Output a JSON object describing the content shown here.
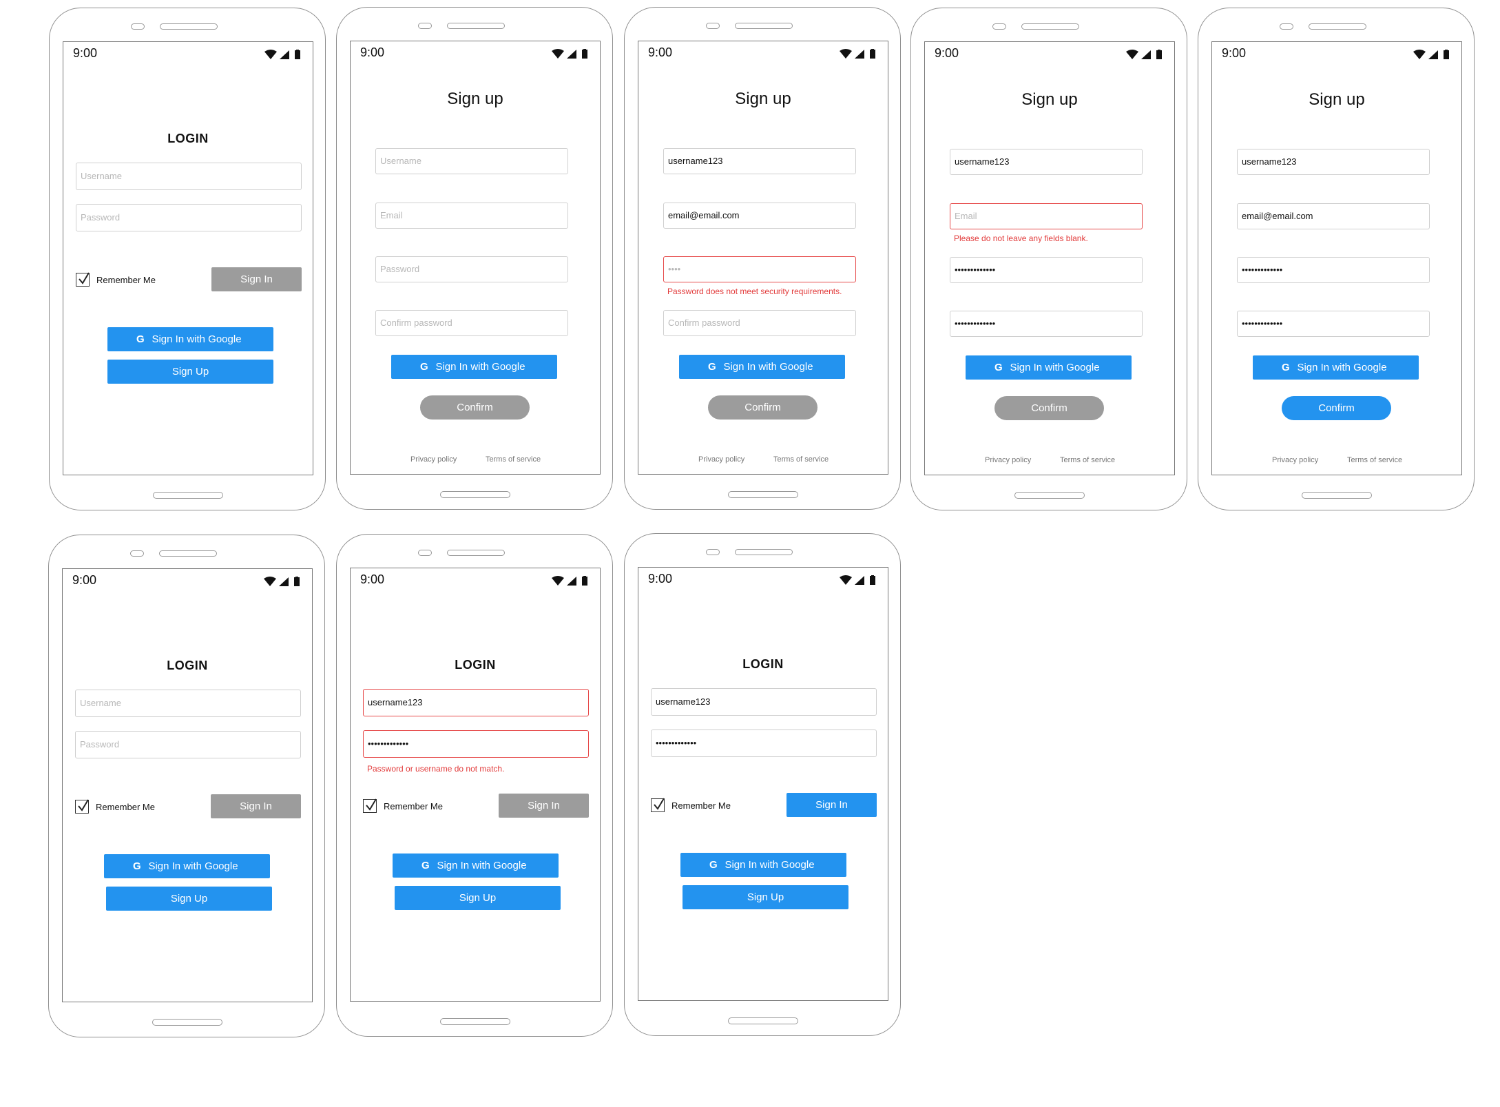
{
  "status_time": "9:00",
  "login": {
    "title": "LOGIN",
    "username_placeholder": "Username",
    "password_placeholder": "Password",
    "remember_label": "Remember Me",
    "sign_in_label": "Sign In",
    "google_label": "Sign In with Google",
    "sign_up_label": "Sign Up"
  },
  "signup": {
    "title": "Sign up",
    "username_placeholder": "Username",
    "email_placeholder": "Email",
    "password_placeholder": "Password",
    "confirm_placeholder": "Confirm password",
    "google_label": "Sign In with Google",
    "confirm_label": "Confirm",
    "privacy_label": "Privacy policy",
    "terms_label": "Terms of service"
  },
  "values": {
    "username": "username123",
    "email": "email@email.com",
    "password_short": "••••",
    "password_masked": "•••••••••••••",
    "google_glyph": "G"
  },
  "errors": {
    "password_requirements": "Password does not meet security requirements.",
    "blank_fields": "Please do not leave any fields blank.",
    "mismatch": "Password or username do not match."
  },
  "colors": {
    "accent": "#2393ef",
    "disabled": "#9c9c9c",
    "error": "#e64a4a"
  }
}
